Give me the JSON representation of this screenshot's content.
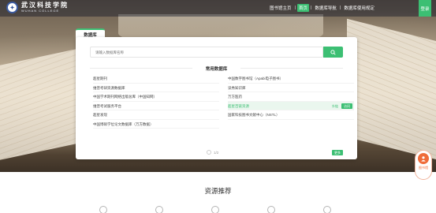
{
  "header": {
    "logo_text": "武汉科技学院",
    "logo_subtext": "WUHAN COLLEGE",
    "nav": [
      {
        "label": "图书馆主页",
        "active": false
      },
      {
        "label": "首页",
        "active": true
      },
      {
        "label": "数据库导航",
        "active": false
      },
      {
        "label": "数据库使用规定",
        "active": false
      }
    ],
    "login_label": "登录"
  },
  "panel": {
    "tab_label": "数据库",
    "search_placeholder": "请输入数据库名称",
    "section_title": "常用数据库",
    "left_items": [
      "超星期刊",
      "维普考研资源数据库",
      "中国学术期刊网络出版总库（中国知网）",
      "维普考试服务平台",
      "超星发现",
      "中国博硕学位论文数据库（万方数据）"
    ],
    "right_items": [
      "中国数字图书馆（Apabi电子图书）",
      "读秀知识库",
      "万方医药",
      "超星百链资源",
      "国家科技图书文献中心（NSTL）"
    ],
    "highlight_tag": "外链",
    "highlight_link": "访问",
    "pager_text": "1/2",
    "more_label": "更多"
  },
  "float_widget": {
    "label": "图书馆"
  },
  "recommend": {
    "title": "资源推荐"
  },
  "colors": {
    "accent": "#3cbf73",
    "widget": "#ef6c3a"
  }
}
